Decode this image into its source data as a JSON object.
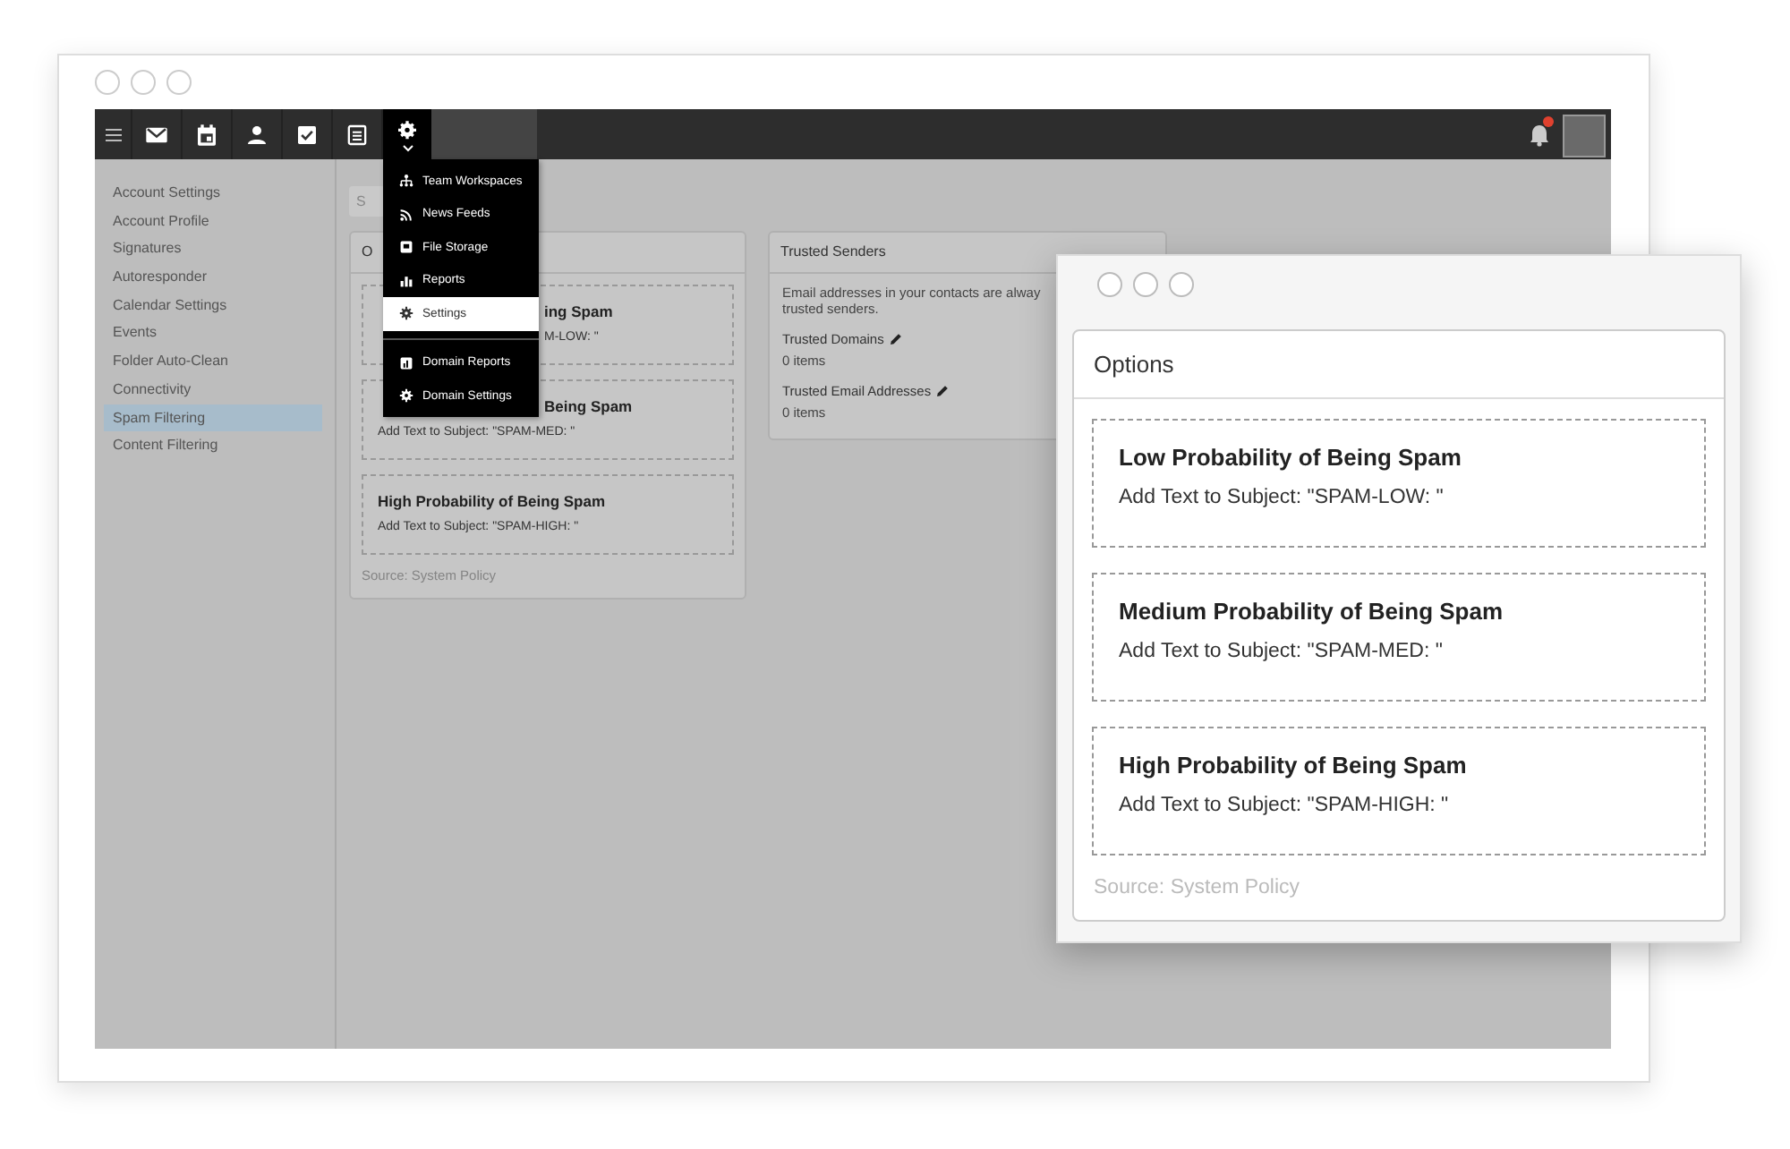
{
  "back_window": {
    "toolbar": {
      "apps": [
        {
          "kind": "mail",
          "selected": false
        },
        {
          "kind": "calendar",
          "selected": false
        },
        {
          "kind": "contacts",
          "selected": false
        },
        {
          "kind": "tasks",
          "selected": false
        },
        {
          "kind": "notes",
          "selected": false
        },
        {
          "kind": "settings",
          "selected": true
        }
      ]
    },
    "sidebar": {
      "items": [
        {
          "label": "Account Settings",
          "selected": false
        },
        {
          "label": "Account Profile",
          "selected": false
        },
        {
          "label": "Signatures",
          "selected": false
        },
        {
          "label": "Autoresponder",
          "selected": false
        },
        {
          "label": "Calendar Settings",
          "selected": false
        },
        {
          "label": "Events",
          "selected": false
        },
        {
          "label": "Folder Auto-Clean",
          "selected": false
        },
        {
          "label": "Connectivity",
          "selected": false
        },
        {
          "label": "Spam Filtering",
          "selected": true
        },
        {
          "label": "Content Filtering",
          "selected": false
        }
      ]
    },
    "small_button": {
      "label": "S"
    },
    "options_card": {
      "title": "O",
      "sections": [
        {
          "kind": "covered",
          "title": "ing Spam",
          "subtitle": "M-LOW: \""
        },
        {
          "kind": "title_covered",
          "title": "Being Spam",
          "subtitle": "Add Text to Subject: \"SPAM-MED: \""
        },
        {
          "kind": "open",
          "title": "High Probability of Being Spam",
          "subtitle": "Add Text to Subject: \"SPAM-HIGH: \""
        }
      ],
      "source": "Source: System Policy"
    },
    "trusted_senders": {
      "title": "Trusted Senders",
      "description_lines": [
        "Email addresses in your contacts are alway",
        "trusted senders."
      ],
      "fields": [
        {
          "label": "Trusted Domains",
          "value": "0 items"
        },
        {
          "label": "Trusted Email Addresses",
          "value": "0 items"
        }
      ]
    },
    "menu": {
      "groups": [
        {
          "items": [
            {
              "kind": "workspaces",
              "label": "Team Workspaces",
              "selected": false
            },
            {
              "kind": "feeds",
              "label": "News Feeds",
              "selected": false
            },
            {
              "kind": "storage",
              "label": "File Storage",
              "selected": false
            },
            {
              "kind": "reports",
              "label": "Reports",
              "selected": false
            },
            {
              "kind": "settings",
              "label": "Settings",
              "selected": true
            }
          ]
        },
        {
          "items": [
            {
              "kind": "domain_reports",
              "label": "Domain Reports",
              "selected": false
            },
            {
              "kind": "domain_settings",
              "label": "Domain Settings",
              "selected": false
            }
          ]
        }
      ]
    }
  },
  "front_window": {
    "options_card": {
      "title": "Options",
      "sections": [
        {
          "title": "Low Probability of Being Spam",
          "subtitle": "Add Text to Subject: \"SPAM-LOW: \""
        },
        {
          "title": "Medium Probability of Being Spam",
          "subtitle": "Add Text to Subject: \"SPAM-MED: \""
        },
        {
          "title": "High Probability of Being Spam",
          "subtitle": "Add Text to Subject: \"SPAM-HIGH: \""
        }
      ],
      "source": "Source: System Policy"
    }
  }
}
